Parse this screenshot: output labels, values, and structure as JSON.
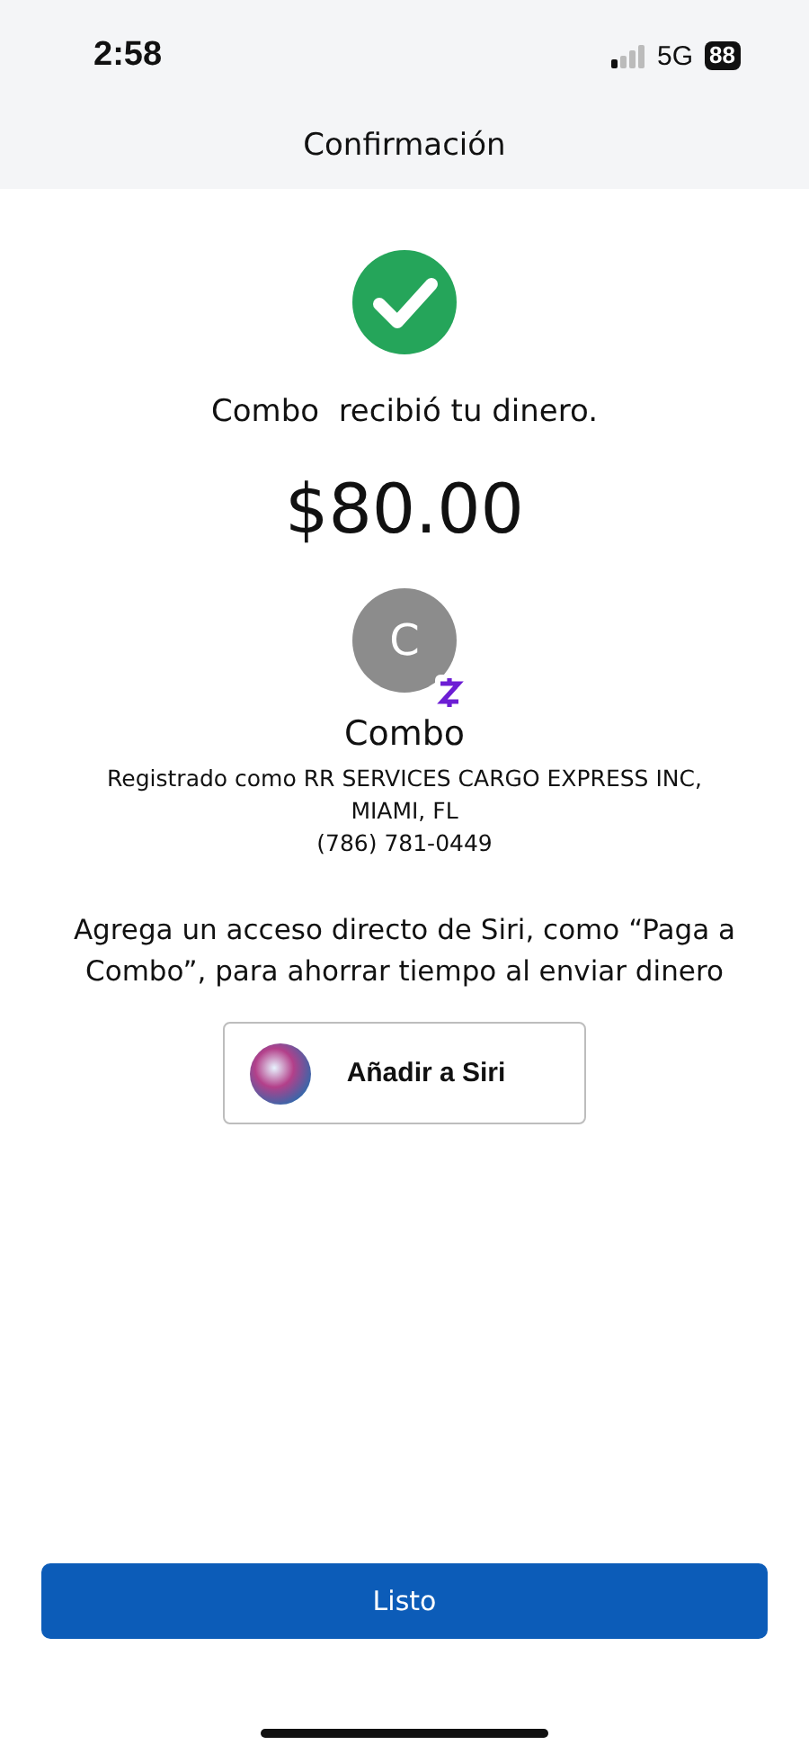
{
  "status_bar": {
    "time": "2:58",
    "network": "5G",
    "battery": "88"
  },
  "header": {
    "title": "Confirmación"
  },
  "confirmation": {
    "message": "Combo  recibió tu dinero.",
    "amount": "$80.00"
  },
  "recipient": {
    "initial": "C",
    "name": "Combo",
    "registered_as": "Registrado como RR SERVICES CARGO EXPRESS INC,",
    "location": "MIAMI, FL",
    "phone": "(786) 781-0449"
  },
  "siri": {
    "text": "Agrega un acceso directo de Siri, como “Paga a Combo”, para ahorrar tiempo al enviar dinero",
    "button": "Añadir a Siri"
  },
  "done_button": "Listo"
}
